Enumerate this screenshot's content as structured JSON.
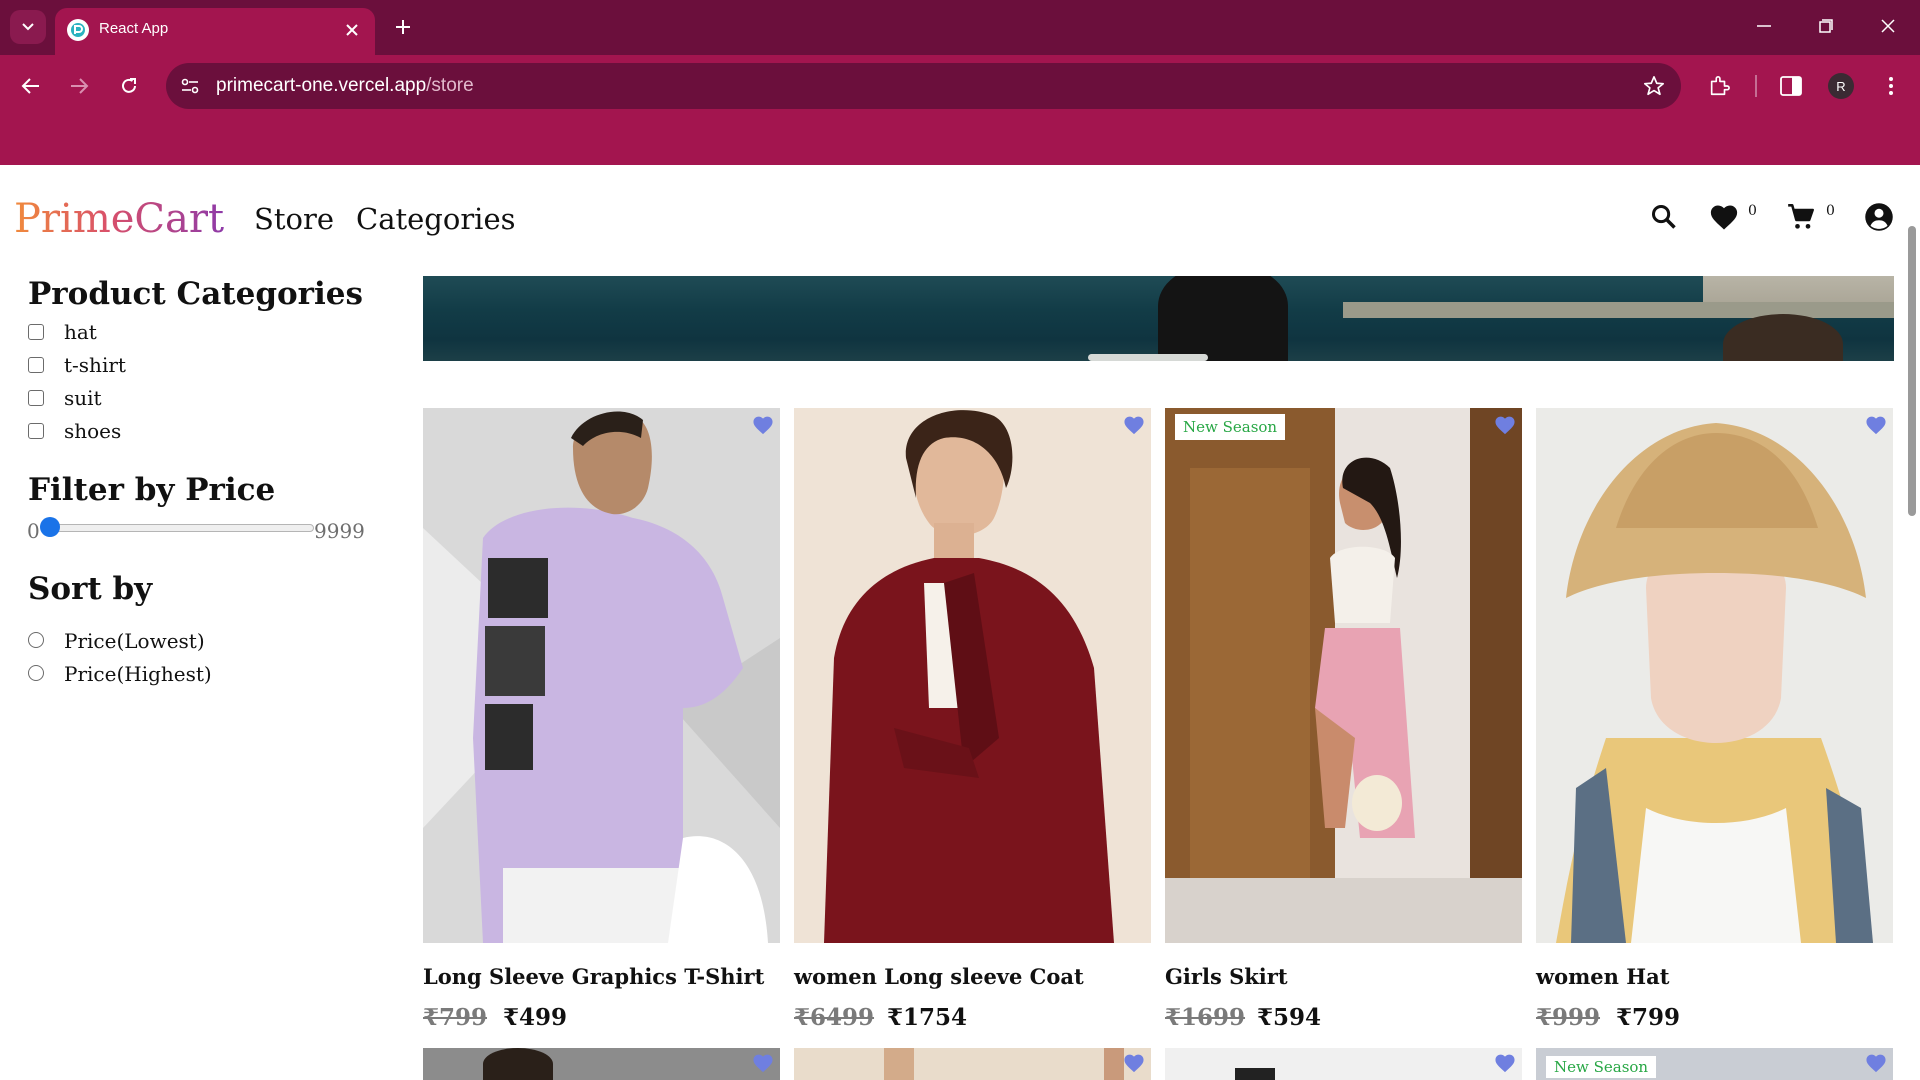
{
  "browser": {
    "tab_title": "React App",
    "url_host": "primecart-one.vercel.app",
    "url_path": "/store",
    "profile_initial": "R"
  },
  "header": {
    "logo": "PrimeCart",
    "nav": [
      "Store",
      "Categories"
    ],
    "wishlist_count": "0",
    "cart_count": "0"
  },
  "sidebar": {
    "categories_title": "Product Categories",
    "categories": [
      "hat",
      "t-shirt",
      "suit",
      "shoes"
    ],
    "price_title": "Filter by Price",
    "price_min": "0",
    "price_max": "9999",
    "price_value": 0,
    "sort_title": "Sort by",
    "sort_options": [
      "Price(Lowest)",
      "Price(Highest)"
    ]
  },
  "colors": {
    "tabstrip": "#6b0f3c",
    "toolbar": "#a3154f",
    "wishlist_heart": "#6f7fe0",
    "new_season": "#28a745"
  },
  "products": [
    {
      "name": "Long Sleeve Graphics T-Shirt",
      "price_old": "₹799",
      "price_new": "₹499",
      "badge": ""
    },
    {
      "name": "women Long sleeve Coat",
      "price_old": "₹6499",
      "price_new": "₹1754",
      "badge": ""
    },
    {
      "name": "Girls Skirt",
      "price_old": "₹1699",
      "price_new": "₹594",
      "badge": "New Season"
    },
    {
      "name": "women Hat",
      "price_old": "₹999",
      "price_new": "₹799",
      "badge": ""
    }
  ],
  "next_row_badge": "New Season"
}
